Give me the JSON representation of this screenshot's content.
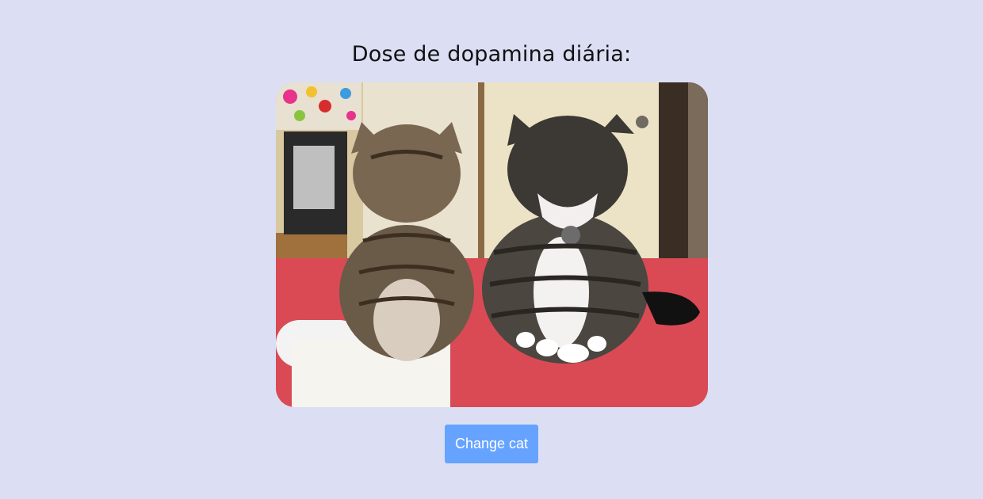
{
  "header": {
    "title": "Dose de dopamina diária:"
  },
  "image": {
    "icon": "cat-photo",
    "subject": "two tabby cats looking down"
  },
  "actions": {
    "change_cat_label": "Change cat"
  },
  "colors": {
    "background": "#dcdff3",
    "button": "#66a3ff",
    "title": "#111111"
  }
}
